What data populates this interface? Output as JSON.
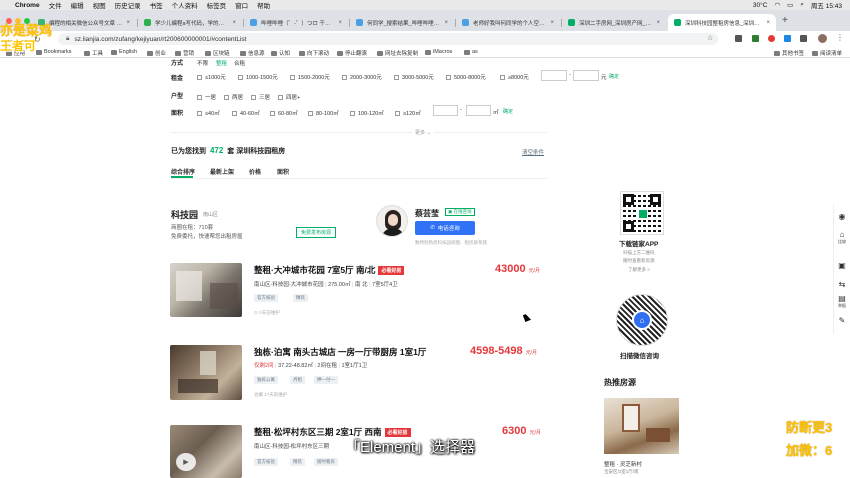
{
  "menubar": {
    "app": "Chrome",
    "items": [
      "文件",
      "编辑",
      "视图",
      "历史记录",
      "书签",
      "个人资料",
      "标签页",
      "窗口",
      "帮助"
    ],
    "status": [
      "30°C",
      "15:43"
    ],
    "clock": "周五 15:43"
  },
  "tabs": [
    {
      "label": "编程的相关微信公众号文章 - 搜…",
      "color": "#3cb371"
    },
    {
      "label": "学少儿编程a写代码，学的着嘛…",
      "color": "#2db14b"
    },
    {
      "label": "哔哩哔哩（゜-゜）つロ 干杯~-bili…",
      "color": "#4aa0e6"
    },
    {
      "label": "何同学_搜索结果_哔哩哔哩_bili…",
      "color": "#4aa0e6"
    },
    {
      "label": "老师好我叫何同学的个人空间_哔…",
      "color": "#4aa0e6"
    },
    {
      "label": "深圳二手房网_深圳房产网_深圳…",
      "color": "#00ae66"
    },
    {
      "label": "深圳科技园整租房信息_深圳…",
      "color": "#00ae66"
    }
  ],
  "url": "sz.lianjia.com/zufang/kejiyuan/rt200600000001/#contentList",
  "bookmarks": [
    "应用",
    "Bookmarks",
    "工具",
    "English",
    "创业",
    "营销",
    "区块链",
    "信息源",
    "认知",
    "向下滚动",
    "停止翻滚",
    "网址去除复制",
    "iMacros",
    "as",
    "其他书签",
    "阅读清单"
  ],
  "filters": {
    "mode": {
      "label": "方式",
      "options": [
        "不限",
        "整租",
        "合租"
      ]
    },
    "rent": {
      "label": "租金",
      "options": [
        "≤1000元",
        "1000-1500元",
        "1500-2000元",
        "2000-3000元",
        "3000-5000元",
        "5000-8000元",
        "≥8000元"
      ],
      "sep": "-",
      "unit": "元",
      "confirm": "确定"
    },
    "layout": {
      "label": "户型",
      "options": [
        "一居",
        "两居",
        "三居",
        "四居+"
      ]
    },
    "area": {
      "label": "面积",
      "options": [
        "≤40㎡",
        "40-60㎡",
        "60-80㎡",
        "80-100㎡",
        "100-120㎡",
        "≥120㎡"
      ],
      "sep": "-",
      "unit": "㎡",
      "confirm": "确定"
    },
    "more": "更多"
  },
  "results": {
    "prefix": "已为您找到",
    "count": "472",
    "suffix": "套 深圳科技园租房",
    "clear": "清空条件"
  },
  "sort_tabs": [
    "综合排序",
    "最新上架",
    "价格",
    "面积"
  ],
  "area_info": {
    "name": "科技园",
    "district": "南山区",
    "listing_count": "商圈在租：710套",
    "free_line": "免费委托，快速帮您出租房屋",
    "free_button": "免费发布房源"
  },
  "agent": {
    "name": "蔡芸莹",
    "badge": "在线咨询",
    "call_button": "电话咨询",
    "desc": "数特别熟悉科技园商圈、租房联系我"
  },
  "listings": [
    {
      "title": "整租·大冲城市花园 7室5厅 南/北",
      "badge": "必看好房",
      "price": "43000",
      "unit": "元/月",
      "info": [
        "南山区-科技园-大冲城市花园",
        "275.00㎡",
        "南 北",
        "7室5厅4卫"
      ],
      "tags": [
        "官方核验",
        "精装"
      ],
      "note": "2天前维护"
    },
    {
      "title": "独栋·泊寓 南头古城店 一房一厅带厨房 1室1厅",
      "badge": "",
      "price": "4598-5498",
      "unit": "元/月",
      "info": [
        "仅剩2间",
        "37.22-48.82㎡",
        "2间在租",
        "1室1厅1卫"
      ],
      "tags": [
        "独栋公寓",
        "月租",
        "押一付一"
      ],
      "note": "泊寓   17天前维护"
    },
    {
      "title": "整租·松坪村东区三期 2室1厅 西南",
      "badge": "必看好房",
      "price": "6300",
      "unit": "元/月",
      "info": [
        "南山区-科技园-松坪村东区三期",
        "",
        "",
        ""
      ],
      "tags": [
        "官方核验",
        "精装",
        "随时看房"
      ],
      "note": ""
    }
  ],
  "app_promo": {
    "title": "下载链家APP",
    "line1": "扫描上方二维码",
    "line2": "随时查看新房源",
    "link": "了解更多 >"
  },
  "wechat_promo": {
    "title": "扫描微信咨询"
  },
  "hot": {
    "title": "热推房源",
    "caption": "整租 · 灵芝新村",
    "sub": "宝安区/2室1厅/南"
  },
  "right_sidebar": [
    "在线",
    "比较",
    "地图",
    "举报"
  ],
  "subtitle": "「Element」选择器",
  "watermarks": {
    "tl_top": "亦是菜鸡",
    "tl_bottom": "王者可",
    "br_top": "防断更3",
    "br_bottom": "加微：6"
  }
}
